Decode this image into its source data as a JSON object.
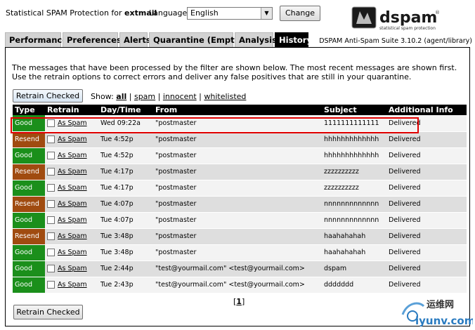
{
  "header": {
    "title_prefix": "Statistical SPAM Protection for",
    "user": "extmail",
    "language_label": "Language",
    "language_value": "English",
    "change_label": "Change",
    "logo_text": "dspam",
    "logo_subtext": "statistical spam protection",
    "suite_version": "DSPAM Anti-Spam Suite 3.10.2 (agent/library)"
  },
  "tabs": [
    {
      "label": "Performance"
    },
    {
      "label": "Preferences"
    },
    {
      "label": "Alerts"
    },
    {
      "label": "Quarantine (Empty)"
    },
    {
      "label": "Analysis"
    },
    {
      "label": "History",
      "active": true
    }
  ],
  "intro_text": "The messages that have been processed by the filter are shown below. The most recent messages are shown first. Use the retrain options to correct errors and deliver any false positives that are still in your quarantine.",
  "retrain_label": "Retrain Checked",
  "show": {
    "label": "Show:",
    "options": [
      "all",
      "spam",
      "innocent",
      "whitelisted"
    ],
    "selected": "all"
  },
  "table": {
    "columns": [
      "Type",
      "Retrain",
      "Day/Time",
      "From",
      "Subject",
      "Additional Info"
    ],
    "retrain_link": "As Spam",
    "rows": [
      {
        "type": "Good",
        "time": "Wed 09:22a",
        "from": "\"postmaster",
        "subject": "1111111111111",
        "info": "Delivered"
      },
      {
        "type": "Resend",
        "time": "Tue 4:52p",
        "from": "\"postmaster",
        "subject": "hhhhhhhhhhhhh",
        "info": "Delivered"
      },
      {
        "type": "Good",
        "time": "Tue 4:52p",
        "from": "\"postmaster",
        "subject": "hhhhhhhhhhhhh",
        "info": "Delivered"
      },
      {
        "type": "Resend",
        "time": "Tue 4:17p",
        "from": "\"postmaster",
        "subject": "zzzzzzzzzz",
        "info": "Delivered"
      },
      {
        "type": "Good",
        "time": "Tue 4:17p",
        "from": "\"postmaster",
        "subject": "zzzzzzzzzz",
        "info": "Delivered"
      },
      {
        "type": "Resend",
        "time": "Tue 4:07p",
        "from": "\"postmaster",
        "subject": "nnnnnnnnnnnnn",
        "info": "Delivered"
      },
      {
        "type": "Good",
        "time": "Tue 4:07p",
        "from": "\"postmaster",
        "subject": "nnnnnnnnnnnnn",
        "info": "Delivered"
      },
      {
        "type": "Resend",
        "time": "Tue 3:48p",
        "from": "\"postmaster",
        "subject": "haahahahah",
        "info": "Delivered"
      },
      {
        "type": "Good",
        "time": "Tue 3:48p",
        "from": "\"postmaster",
        "subject": "haahahahah",
        "info": "Delivered"
      },
      {
        "type": "Good",
        "time": "Tue 2:44p",
        "from": "\"test@yourmail.com\" <test@yourmail.com>",
        "subject": "dspam",
        "info": "Delivered"
      },
      {
        "type": "Good",
        "time": "Tue 2:43p",
        "from": "\"test@yourmail.com\" <test@yourmail.com>",
        "subject": "ddddddd",
        "info": "Delivered"
      }
    ]
  },
  "pager": {
    "open": "[",
    "current": "1",
    "close": "]"
  },
  "watermark": {
    "cn": "运维网",
    "url": "iyunv.com"
  },
  "colors": {
    "good": "#1b8f1b",
    "resend": "#a04b10",
    "highlight": "#e00000"
  }
}
